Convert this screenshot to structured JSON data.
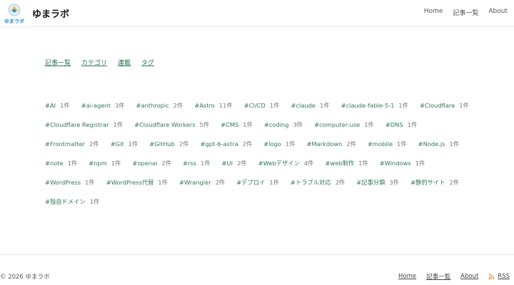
{
  "header": {
    "logo_text": "ゆまラボ",
    "site_title": "ゆまラボ",
    "nav": [
      "Home",
      "記事一覧",
      "About"
    ]
  },
  "subnav": [
    "記事一覧",
    "カテゴリ",
    "連載",
    "タグ"
  ],
  "tags": [
    [
      {
        "name": "#AI",
        "count": "1件"
      },
      {
        "name": "#ai-agent",
        "count": "3件"
      },
      {
        "name": "#anthropic",
        "count": "2件"
      },
      {
        "name": "#Astro",
        "count": "11件"
      },
      {
        "name": "#CI/CD",
        "count": "1件"
      },
      {
        "name": "#claude",
        "count": "1件"
      },
      {
        "name": "#claude-fable-5-1",
        "count": "1件"
      },
      {
        "name": "#Cloudflare",
        "count": "1件"
      }
    ],
    [
      {
        "name": "#Cloudflare Registrar",
        "count": "1件"
      },
      {
        "name": "#Cloudflare Workers",
        "count": "5件"
      },
      {
        "name": "#CMS",
        "count": "1件"
      },
      {
        "name": "#coding",
        "count": "3件"
      },
      {
        "name": "#computer-use",
        "count": "1件"
      },
      {
        "name": "#DNS",
        "count": "1件"
      }
    ],
    [
      {
        "name": "#Frontmatter",
        "count": "2件"
      },
      {
        "name": "#Git",
        "count": "1件"
      },
      {
        "name": "#GitHub",
        "count": "2件"
      },
      {
        "name": "#gpt-6-astra",
        "count": "2件"
      },
      {
        "name": "#logo",
        "count": "1件"
      },
      {
        "name": "#Markdown",
        "count": "2件"
      },
      {
        "name": "#mobile",
        "count": "1件"
      },
      {
        "name": "#Node.js",
        "count": "1件"
      }
    ],
    [
      {
        "name": "#note",
        "count": "1件"
      },
      {
        "name": "#npm",
        "count": "1件"
      },
      {
        "name": "#openai",
        "count": "2件"
      },
      {
        "name": "#rss",
        "count": "1件"
      },
      {
        "name": "#UI",
        "count": "2件"
      },
      {
        "name": "#Webデザイン",
        "count": "4件"
      },
      {
        "name": "#web制作",
        "count": "1件"
      },
      {
        "name": "#Windows",
        "count": "1件"
      }
    ],
    [
      {
        "name": "#WordPress",
        "count": "1件"
      },
      {
        "name": "#WordPress代替",
        "count": "1件"
      },
      {
        "name": "#Wrangler",
        "count": "2件"
      },
      {
        "name": "#デプロイ",
        "count": "1件"
      },
      {
        "name": "#トラブル対応",
        "count": "2件"
      },
      {
        "name": "#記事分類",
        "count": "3件"
      },
      {
        "name": "#静的サイト",
        "count": "2件"
      }
    ],
    [
      {
        "name": "#独自ドメイン",
        "count": "1件"
      }
    ]
  ],
  "footer": {
    "copyright": "© 2026 ゆまラボ",
    "nav": [
      "Home",
      "記事一覧",
      "About"
    ],
    "rss": "RSS"
  },
  "colors": {
    "accent": "#2f7a55",
    "logo_blue": "#2f8fd6",
    "rss_orange": "#e08a2a"
  }
}
